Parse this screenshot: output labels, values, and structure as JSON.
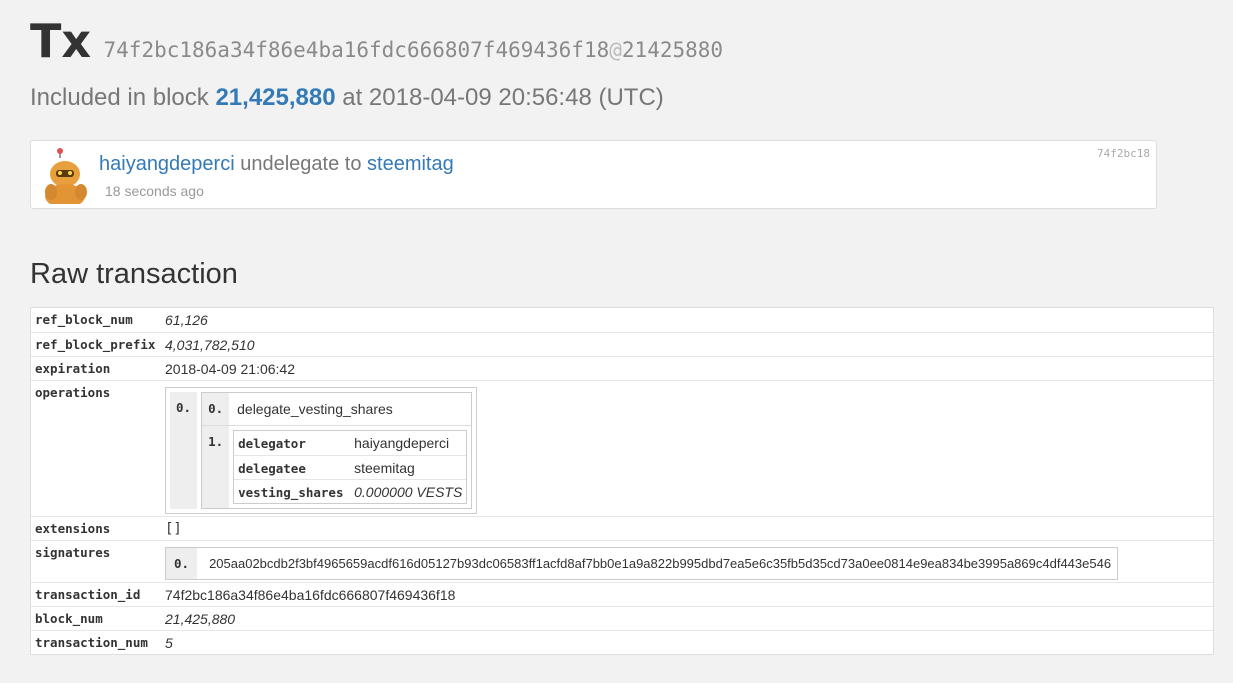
{
  "header": {
    "title": "Tx",
    "tx_hash": "74f2bc186a34f86e4ba16fdc666807f469436f18",
    "at_sign": "@",
    "block_ref": "21425880"
  },
  "included": {
    "prefix": "Included in block",
    "block": "21,425,880",
    "suffix": "at 2018-04-09 20:56:48 (UTC)"
  },
  "operation_card": {
    "account": "haiyangdeperci",
    "action": "undelegate to",
    "target": "steemitag",
    "time_ago": "18 seconds ago",
    "short_hash": "74f2bc18"
  },
  "raw": {
    "title": "Raw transaction",
    "ref_block_num": {
      "key": "ref_block_num",
      "value": "61,126"
    },
    "ref_block_prefix": {
      "key": "ref_block_prefix",
      "value": "4,031,782,510"
    },
    "expiration": {
      "key": "expiration",
      "value": "2018-04-09 21:06:42"
    },
    "operations": {
      "key": "operations",
      "index0": "0.",
      "sub_index0": "0.",
      "op_name": "delegate_vesting_shares",
      "sub_index1": "1.",
      "params": [
        {
          "key": "delegator",
          "value": "haiyangdeperci"
        },
        {
          "key": "delegatee",
          "value": "steemitag"
        },
        {
          "key": "vesting_shares",
          "value": "0.000000 VESTS"
        }
      ]
    },
    "extensions": {
      "key": "extensions",
      "value": "[]"
    },
    "signatures": {
      "key": "signatures",
      "index": "0.",
      "value": "205aa02bcdb2f3bf4965659acdf616d05127b93dc06583ff1acfd8af7bb0e1a9a822b995dbd7ea5e6c35fb5d35cd73a0ee0814e9ea834be3995a869c4df443e546"
    },
    "transaction_id": {
      "key": "transaction_id",
      "value": "74f2bc186a34f86e4ba16fdc666807f469436f18"
    },
    "block_num": {
      "key": "block_num",
      "value": "21,425,880"
    },
    "transaction_num": {
      "key": "transaction_num",
      "value": "5"
    }
  },
  "colors": {
    "link": "#337ab7",
    "background": "#f2f2f2"
  }
}
